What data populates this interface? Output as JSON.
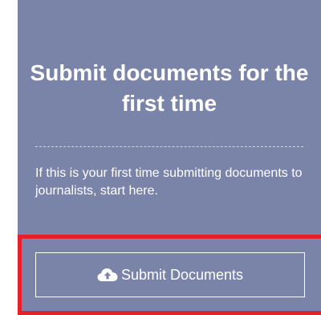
{
  "card": {
    "title": "Submit documents for the first time",
    "description": "If this is your first time submitting documents to journalists, start here."
  },
  "submit_button": {
    "label": "Submit Documents",
    "icon": "cloud-upload-icon"
  },
  "colors": {
    "panel_background": "#7a84a8",
    "text": "#ffffff",
    "highlight_border": "#e5202a"
  }
}
